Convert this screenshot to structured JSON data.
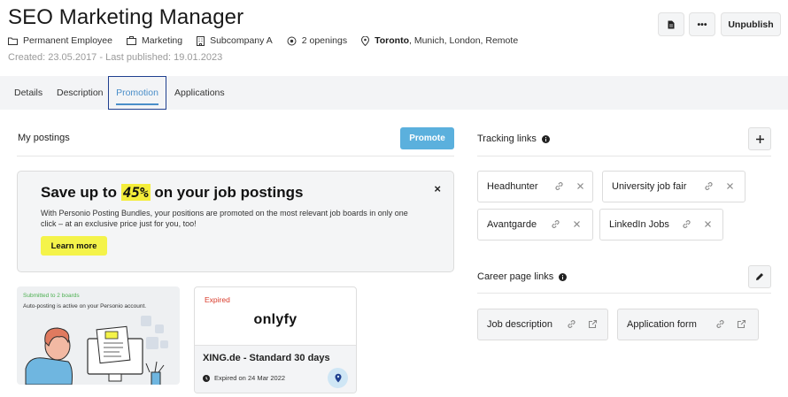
{
  "header": {
    "title": "SEO Marketing Manager",
    "meta": {
      "employment": "Permanent Employee",
      "department": "Marketing",
      "company": "Subcompany A",
      "openings": "2 openings",
      "location_primary": "Toronto",
      "location_rest": ", Munich, London, Remote"
    },
    "created": "Created: 23.05.2017 - Last published: 19.01.2023",
    "actions": {
      "unpublish_label": "Unpublish",
      "more_label": "•••"
    }
  },
  "tabs": [
    {
      "label": "Details"
    },
    {
      "label": "Description"
    },
    {
      "label": "Promotion"
    },
    {
      "label": "Applications"
    }
  ],
  "postings": {
    "title": "My postings",
    "promote_label": "Promote",
    "banner": {
      "heading_before": "Save up to ",
      "heading_highlight": "45%",
      "heading_after": " on your job postings",
      "body": "With Personio Posting Bundles, your positions are promoted on the most relevant job boards in only one click – at an exclusive price just for you, too!",
      "cta_label": "Learn more",
      "close_label": "×"
    },
    "cards": [
      {
        "status": "Submitted to 2 boards",
        "text": "Auto-posting is active on your Personio account."
      },
      {
        "status": "Expired",
        "logo": "onlyfy",
        "name": "XING.de - Standard 30 days",
        "expiry": "Expired on 24 Mar 2022"
      }
    ]
  },
  "tracking": {
    "title": "Tracking links",
    "links": [
      {
        "label": "Headhunter"
      },
      {
        "label": "University job fair"
      },
      {
        "label": "Avantgarde"
      },
      {
        "label": "LinkedIn Jobs"
      }
    ]
  },
  "career": {
    "title": "Career page links",
    "links": [
      {
        "label": "Job description"
      },
      {
        "label": "Application form"
      }
    ]
  },
  "colors": {
    "accent": "#5bb0dd",
    "highlight": "#f4f34a",
    "expired": "#d93b2b",
    "submitted": "#4caf50"
  }
}
